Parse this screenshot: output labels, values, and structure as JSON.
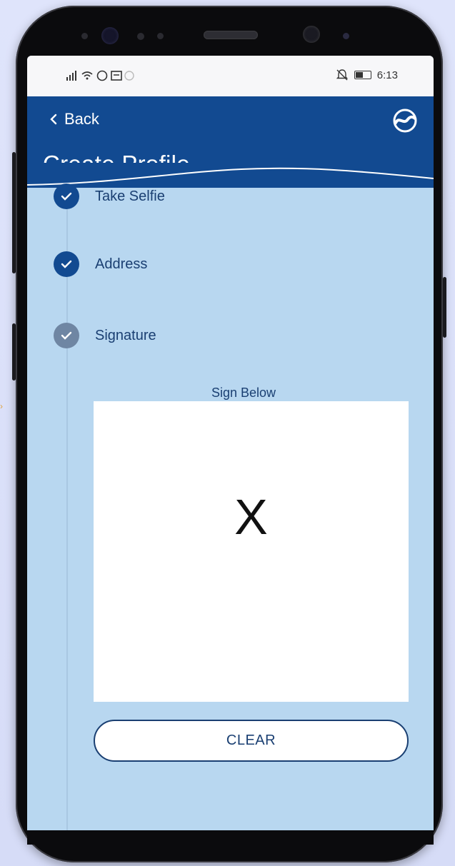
{
  "status_bar": {
    "left_icons": "signal wifi whatsapp messages",
    "time": "6:13"
  },
  "header": {
    "back_label": "Back",
    "title": "Create Profile",
    "bg_color": "#124a91"
  },
  "steps": [
    {
      "label": "Take Selfie",
      "state": "done"
    },
    {
      "label": "Address",
      "state": "done"
    },
    {
      "label": "Signature",
      "state": "pending"
    }
  ],
  "signature": {
    "label": "Sign Below",
    "mark": "X"
  },
  "clear_button": {
    "label": "CLEAR"
  }
}
